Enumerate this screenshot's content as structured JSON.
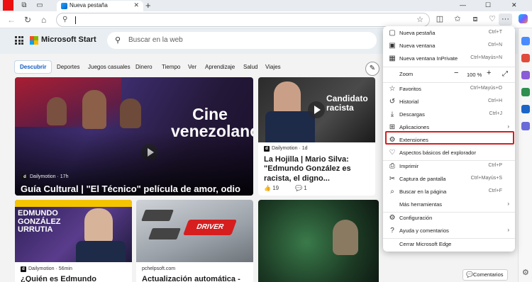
{
  "browser": {
    "tab_title": "Nueva pestaña",
    "tab_close": "✕",
    "new_tab": "+",
    "window_controls": {
      "minimize": "—",
      "maximize": "☐",
      "close": "✕"
    },
    "more_label": "···"
  },
  "msn": {
    "brand": "Microsoft Start",
    "search_placeholder": "Buscar en la web",
    "categories": [
      "Descubrir",
      "Deportes",
      "Juegos casuales",
      "Dinero",
      "Tiempo",
      "Ver",
      "Aprendizaje",
      "Salud",
      "Viajes"
    ]
  },
  "cards": [
    {
      "source": "Dailymotion · 17h",
      "source_badge": "d",
      "title": "Guía Cultural | \"El Técnico\" película de amor, odio y venganza",
      "likes": "6",
      "image_caption": "Cine venezolano"
    },
    {
      "source": "Dailymotion · 1d",
      "source_badge": "d",
      "title": "La Hojilla | Mario Silva: \"Edmundo González es racista, el digno...",
      "likes": "19",
      "comments": "1",
      "image_caption": "Candidato racista"
    },
    {
      "source": "Dailymotion · 56min",
      "source_badge": "d",
      "title": "¿Quién es Edmundo",
      "image_caption": "EDMUNDO GONZÁLEZ URRUTIA"
    },
    {
      "source": "pchelpsoft.com",
      "title": "Actualización automática -",
      "image_caption": "DRIVER"
    }
  ],
  "feedback": "Comentarios",
  "menu": {
    "items": [
      {
        "label": "Nueva pestaña",
        "shortcut": "Ctrl+T",
        "icon": "new-tab-icon"
      },
      {
        "label": "Nueva ventana",
        "shortcut": "Ctrl+N",
        "icon": "new-window-icon"
      },
      {
        "label": "Nueva ventana InPrivate",
        "shortcut": "Ctrl+Mayús+N",
        "icon": "inprivate-icon"
      },
      {
        "label": "Zoom",
        "zoom_value": "100 %",
        "icon": "zoom-icon"
      },
      {
        "label": "Favoritos",
        "shortcut": "Ctrl+Mayús+O",
        "icon": "favorites-icon"
      },
      {
        "label": "Historial",
        "shortcut": "Ctrl+H",
        "icon": "history-icon"
      },
      {
        "label": "Descargas",
        "shortcut": "Ctrl+J",
        "icon": "downloads-icon"
      },
      {
        "label": "Aplicaciones",
        "icon": "apps-icon"
      },
      {
        "label": "Extensiones",
        "icon": "extensions-icon"
      },
      {
        "label": "Aspectos básicos del explorador",
        "icon": "essentials-icon"
      },
      {
        "label": "Imprimir",
        "shortcut": "Ctrl+P",
        "icon": "print-icon"
      },
      {
        "label": "Captura de pantalla",
        "shortcut": "Ctrl+Mayús+S",
        "icon": "screenshot-icon"
      },
      {
        "label": "Buscar en la página",
        "shortcut": "Ctrl+F",
        "icon": "find-icon"
      },
      {
        "label": "Más herramientas",
        "icon": "more-tools-icon"
      },
      {
        "label": "Configuración",
        "icon": "settings-icon"
      },
      {
        "label": "Ayuda y comentarios",
        "icon": "help-icon"
      },
      {
        "label": "Cerrar Microsoft Edge",
        "icon": ""
      }
    ]
  }
}
